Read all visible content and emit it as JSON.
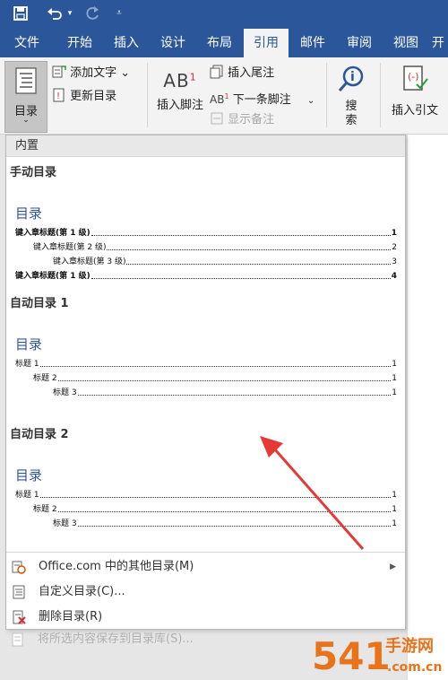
{
  "quick_access": {
    "save_icon": "save-icon",
    "undo_icon": "undo-icon",
    "redo_icon": "redo-icon",
    "customize_icon": "customize-icon"
  },
  "tabs": [
    {
      "label": "文件"
    },
    {
      "label": "开始"
    },
    {
      "label": "插入"
    },
    {
      "label": "设计"
    },
    {
      "label": "布局"
    },
    {
      "label": "引用",
      "active": true
    },
    {
      "label": "邮件"
    },
    {
      "label": "审阅"
    },
    {
      "label": "视图"
    },
    {
      "label": "开"
    }
  ],
  "ribbon": {
    "toc_label": "目录",
    "add_text_label": "添加文字 ⌄",
    "update_toc_label": "更新目录",
    "insert_footnote_label": "插入脚注",
    "insert_endnote_label": "插入尾注",
    "next_footnote_label": "下一条脚注",
    "show_notes_label": "显示备注",
    "search_label_1": "搜",
    "search_label_2": "索",
    "insert_citation_label": "插入引文",
    "ab_text": "AB",
    "ab_sup": "1",
    "ab_small": "AB",
    "ab_small_sup": "1",
    "cut_label": "引"
  },
  "dropdown": {
    "section_header": "内置",
    "galleries": [
      {
        "title": "手动目录",
        "heading": "目录",
        "lines": [
          {
            "text": "键入章标题(第 1 级)",
            "page": "1",
            "level": 1,
            "bold": true
          },
          {
            "text": "键入章标题(第 2 级)",
            "page": "2",
            "level": 2,
            "bold": false
          },
          {
            "text": "键入章标题(第 3 级)",
            "page": "3",
            "level": 3,
            "bold": false
          },
          {
            "text": "键入章标题(第 1 级)",
            "page": "4",
            "level": 1,
            "bold": true
          }
        ]
      },
      {
        "title": "自动目录 1",
        "heading": "目录",
        "lines": [
          {
            "text": "标题 1",
            "page": "1",
            "level": 1
          },
          {
            "text": "标题 2",
            "page": "1",
            "level": 2
          },
          {
            "text": "标题 3",
            "page": "1",
            "level": 3
          }
        ]
      },
      {
        "title": "自动目录 2",
        "heading": "目录",
        "lines": [
          {
            "text": "标题 1",
            "page": "1",
            "level": 1
          },
          {
            "text": "标题 2",
            "page": "1",
            "level": 2
          },
          {
            "text": "标题 3",
            "page": "1",
            "level": 3
          }
        ]
      }
    ],
    "menu": [
      {
        "label": "Office.com 中的其他目录(M)",
        "icon": "office-icon",
        "has_submenu": true,
        "disabled": false
      },
      {
        "label": "自定义目录(C)...",
        "icon": "custom-toc-icon",
        "has_submenu": false,
        "disabled": false
      },
      {
        "label": "删除目录(R)",
        "icon": "remove-toc-icon",
        "has_submenu": false,
        "disabled": false
      },
      {
        "label": "将所选内容保存到目录库(S)...",
        "icon": "save-to-gallery-icon",
        "has_submenu": false,
        "disabled": true
      }
    ]
  },
  "watermark": {
    "text_main": "541",
    "text_sub": "手游网",
    "domain": ".com.cn"
  },
  "colors": {
    "ribbon_blue": "#2b579a",
    "heading_blue": "#2f5496",
    "arrow_red": "#e53935"
  }
}
